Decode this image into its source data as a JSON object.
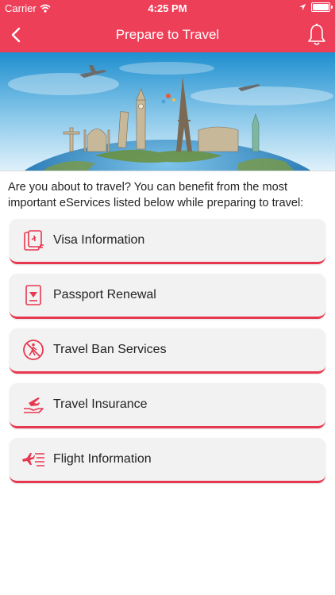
{
  "status_bar": {
    "carrier": "Carrier",
    "time": "4:25 PM",
    "wifi_icon": "wifi-icon",
    "location_icon": "location-arrow-icon",
    "battery_icon": "battery-icon"
  },
  "nav": {
    "title": "Prepare to Travel",
    "back_icon": "chevron-left-icon",
    "bell_icon": "bell-icon"
  },
  "hero": {
    "image": "world-landmarks-travel-banner"
  },
  "intro": "Are you about to travel? You can benefit from the most important eServices listed below while preparing to travel:",
  "services": [
    {
      "label": "Visa Information",
      "icon": "visa-document-icon"
    },
    {
      "label": "Passport Renewal",
      "icon": "passport-icon"
    },
    {
      "label": "Travel Ban Services",
      "icon": "no-travel-icon"
    },
    {
      "label": "Travel Insurance",
      "icon": "hand-plane-icon"
    },
    {
      "label": "Flight Information",
      "icon": "flight-info-icon"
    }
  ],
  "colors": {
    "accent": "#ee3f59",
    "card_bg": "#f2f2f2",
    "card_border": "#e8384f",
    "text": "#222222"
  }
}
